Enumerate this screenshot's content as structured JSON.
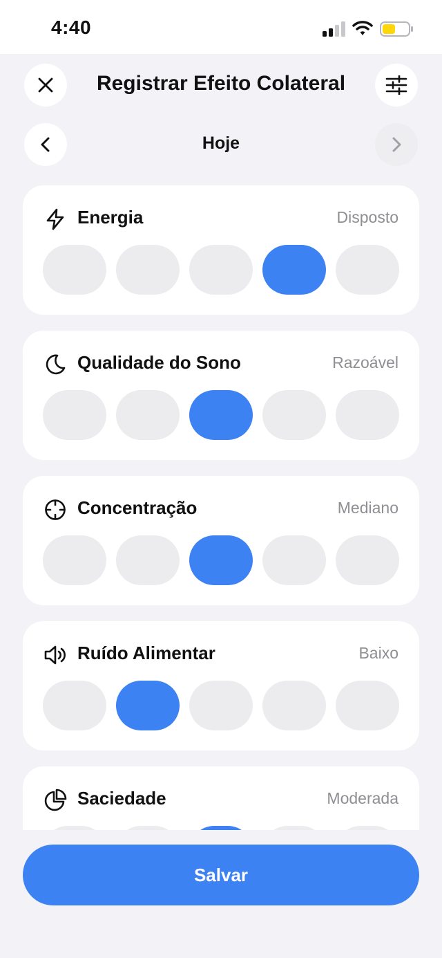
{
  "status_bar": {
    "time": "4:40"
  },
  "header": {
    "title": "Registrar Efeito Colateral",
    "close_icon": "close-icon",
    "settings_icon": "sliders-icon"
  },
  "date_nav": {
    "label": "Hoje",
    "prev_icon": "chevron-left-icon",
    "next_icon": "chevron-right-icon"
  },
  "metrics": [
    {
      "title": "Energia",
      "value": "Disposto",
      "icon": "lightning-icon",
      "selected_level": 4,
      "levels": 5
    },
    {
      "title": "Qualidade do Sono",
      "value": "Razoável",
      "icon": "moon-icon",
      "selected_level": 3,
      "levels": 5
    },
    {
      "title": "Concentração",
      "value": "Mediano",
      "icon": "crosshair-icon",
      "selected_level": 3,
      "levels": 5
    },
    {
      "title": "Ruído Alimentar",
      "value": "Baixo",
      "icon": "speaker-icon",
      "selected_level": 2,
      "levels": 5
    },
    {
      "title": "Saciedade",
      "value": "Moderada",
      "icon": "pie-chart-icon",
      "selected_level": 3,
      "levels": 5
    }
  ],
  "actions": {
    "save_label": "Salvar"
  },
  "colors": {
    "accent": "#3d82f2",
    "background": "#f2f2f7",
    "pill_inactive": "#ececef",
    "muted_text": "#8e8e93"
  }
}
